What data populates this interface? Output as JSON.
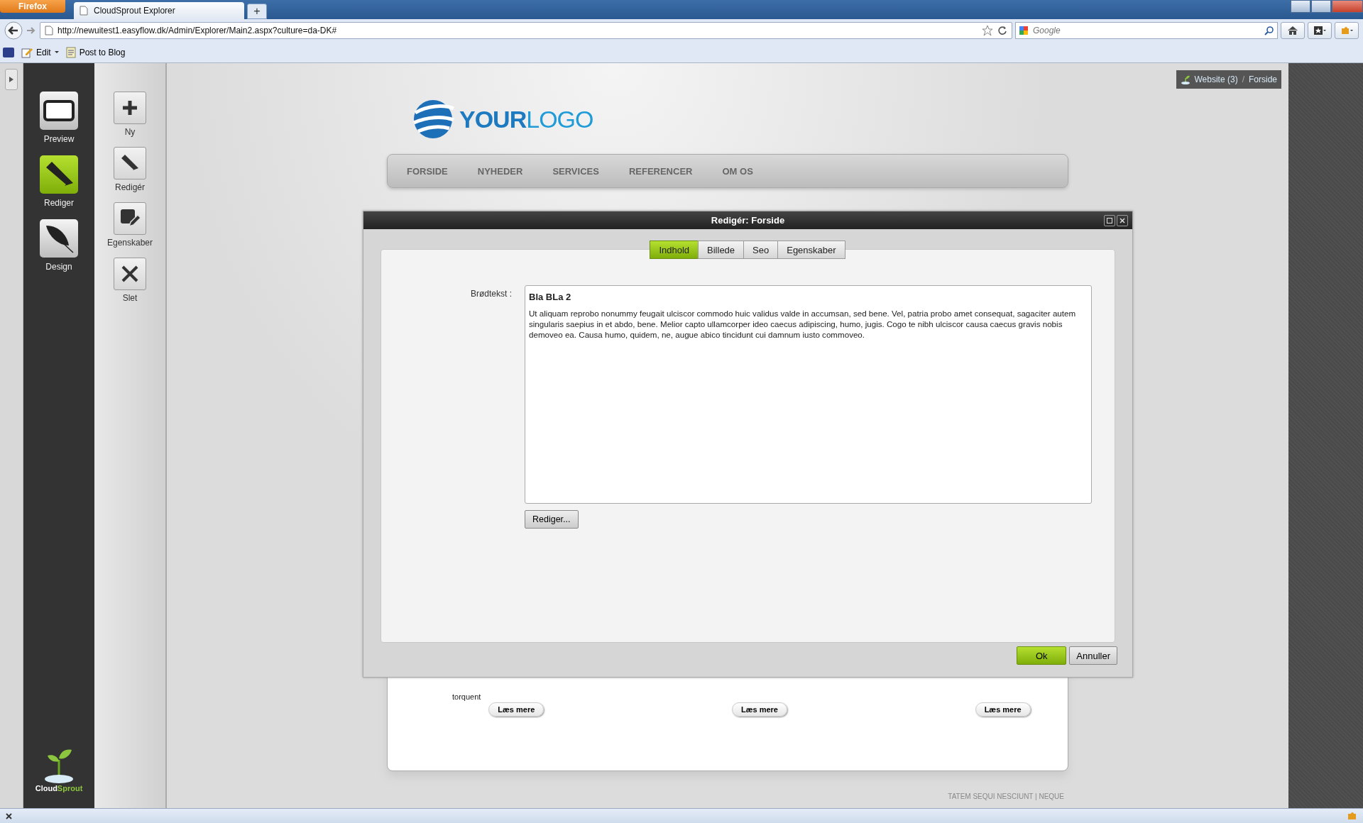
{
  "browser": {
    "menu_button": "Firefox",
    "tab_title": "CloudSprout Explorer",
    "new_tab": "+",
    "url": "http://newuitest1.easyflow.dk/Admin/Explorer/Main2.aspx?culture=da-DK#",
    "search_placeholder": "Google",
    "bookmarks": [
      {
        "label": "Edit",
        "kind": "edit"
      },
      {
        "label": "Post to Blog",
        "kind": "blog"
      }
    ]
  },
  "sidebar": {
    "modes": [
      {
        "label": "Preview",
        "kind": "monitor",
        "selected": false
      },
      {
        "label": "Rediger",
        "kind": "pencil",
        "selected": true
      },
      {
        "label": "Design",
        "kind": "feather",
        "selected": false
      }
    ],
    "brand": [
      "Cloud",
      "Sprout"
    ]
  },
  "toolbar": [
    {
      "label": "Ny",
      "kind": "plus"
    },
    {
      "label": "Redigér",
      "kind": "pencil"
    },
    {
      "label": "Egenskaber",
      "kind": "properties"
    },
    {
      "label": "Slet",
      "kind": "delete"
    }
  ],
  "breadcrumb": {
    "site": "Website (3)",
    "separator": "/",
    "page": "Forside"
  },
  "site": {
    "logo": [
      "YOUR",
      "LOGO"
    ],
    "nav": [
      "FORSIDE",
      "NYHEDER",
      "SERVICES",
      "REFERENCER",
      "OM OS"
    ],
    "card_text": "torquent",
    "read_more": [
      "Læs mere",
      "Læs mere",
      "Læs mere"
    ],
    "footer": "TATEM SEQUI NESCIUNT | NEQUE"
  },
  "dialog": {
    "title": "Redigér: Forside",
    "tabs": [
      {
        "label": "Indhold",
        "selected": true
      },
      {
        "label": "Billede",
        "selected": false
      },
      {
        "label": "Seo",
        "selected": false
      },
      {
        "label": "Egenskaber",
        "selected": false
      }
    ],
    "field_label": "Brødtekst :",
    "editor_heading": "Bla BLa 2",
    "editor_body": "Ut aliquam reprobo nonummy feugait ulciscor commodo huic validus valde in accumsan, sed bene. Vel, patria probo amet consequat, sagaciter autem singularis saepius in et abdo, bene. Melior capto ullamcorper ideo caecus adipiscing, humo, jugis. Cogo te nibh ulciscor causa caecus gravis nobis demoveo ea. Causa humo, quidem, ne, augue abico tincidunt cui damnum iusto commoveo.",
    "edit_button": "Rediger...",
    "ok": "Ok",
    "cancel": "Annuller"
  }
}
